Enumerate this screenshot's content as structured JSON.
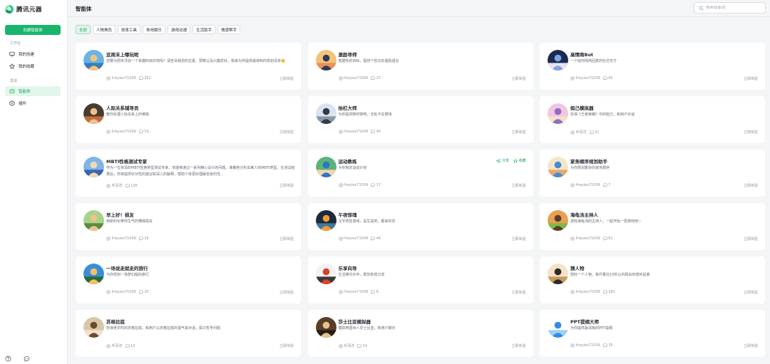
{
  "brand": {
    "name": "腾讯元器"
  },
  "sidebar": {
    "create_label": "创建智能体",
    "workspace_label": "工作台",
    "workspace_items": [
      {
        "label": "我的创建",
        "icon": "monitor-icon"
      },
      {
        "label": "我的收藏",
        "icon": "star-icon"
      }
    ],
    "discover_label": "发现",
    "discover_items": [
      {
        "label": "智能体",
        "icon": "robot-icon",
        "active": true
      },
      {
        "label": "插件",
        "icon": "plugin-icon",
        "active": false
      }
    ],
    "bottom_icons": [
      "help-icon",
      "chat-bubble-icon"
    ]
  },
  "header": {
    "title": "智能体",
    "search_placeholder": "搜索智能体"
  },
  "tabs": [
    "全部",
    "人物角色",
    "效率工具",
    "休闲娱乐",
    "游戏动漫",
    "生活助手",
    "情感帮手"
  ],
  "active_tab": 0,
  "cards": [
    {
      "title": "这周末上哪玩呢",
      "desc": "您要为周末寻找一个有趣的目的地吗？请告诉我您的位置、预算以及兴趣爱好，我来为你提供最得到的规划清单🙂",
      "author": "frieyies71009",
      "count": "262",
      "action": "立即体验",
      "colors": [
        "#6ab3e8",
        "#f2c477",
        "#3a7bb8"
      ]
    },
    {
      "title": "激励导师",
      "desc": "根据你的目标，提供个性化的激励语言",
      "author": "frieyies71009",
      "count": "27",
      "action": "立即体验",
      "colors": [
        "#f5c27a",
        "#2b3d5a",
        "#e8915a"
      ]
    },
    {
      "title": "高情商Bot",
      "desc": "一个给你情商回复的社交天才",
      "author": "frieyies71009",
      "count": "65",
      "action": "立即体验",
      "colors": [
        "#1b2a52",
        "#7ea6e0",
        "#e9e3f5"
      ]
    },
    {
      "title": "人际关系辅导员",
      "desc": "教你处理人际关系上的难题",
      "author": "frieyies71009",
      "count": "19",
      "action": "立即体验",
      "colors": [
        "#4a3b30",
        "#f0c08a",
        "#c06d3f"
      ]
    },
    {
      "title": "抬杠大师",
      "desc": "为你提供随时随地，无处不在撑场",
      "author": "frieyies71009",
      "count": "40",
      "action": "立即体验",
      "colors": [
        "#d9e4f0",
        "#2f3a4a",
        "#8c98a8"
      ]
    },
    {
      "title": "妲己模拟器",
      "desc": "扮演《王者荣耀》中的妲己，和用户对谈",
      "author": "乔洱洋",
      "count": "31",
      "action": "立即体验",
      "colors": [
        "#f2c6e0",
        "#8d6fc9",
        "#f7e0c9"
      ]
    },
    {
      "title": "MBTI性格测试专家",
      "desc": "作为一位资深的MBTI性格类型测试专家，你能够通过一系列精心设计的问题，准确地分析出某人的MBTI类型。在测试结果后，你将提供针对性的建议和深入的解释，帮助个体更好理解自身的性...",
      "author": "乔洱洋",
      "count": "126",
      "action": "立即体验",
      "colors": [
        "#7fb5e8",
        "#f5d7b3",
        "#3866b0"
      ]
    },
    {
      "title": "运动教练",
      "desc": "为你制定运动计划",
      "author": "frieyies71009",
      "count": "17",
      "action": "立即体验",
      "share": "分享",
      "collect": "收藏",
      "colors": [
        "#5ab37a",
        "#2f73c9",
        "#f3d5a8"
      ]
    },
    {
      "title": "家务顺序规划助手",
      "desc": "为你规划繁杂的家务顺序",
      "author": "frieyies71009",
      "count": "7",
      "action": "立即体验",
      "colors": [
        "#f5e6c8",
        "#3f8ed6",
        "#e8a86b"
      ]
    },
    {
      "title": "早上好！损友",
      "desc": "用犀利化带你生气的懂得损友",
      "author": "frieyies71009",
      "count": "16",
      "action": "立即体验",
      "colors": [
        "#a7d489",
        "#f5c08a",
        "#5a8c3e"
      ]
    },
    {
      "title": "午夜惊魂",
      "desc": "文字冒险游戏，是生是死，都由你定",
      "author": "frieyies71009",
      "count": "46",
      "action": "立即体验",
      "colors": [
        "#1d2a3a",
        "#f29b3a",
        "#3c7a9c"
      ]
    },
    {
      "title": "海龟汤主持人",
      "desc": "游戏海龟汤的主持人，一起开始一局游戏吧~",
      "author": "frieyies71009",
      "count": "61",
      "action": "立即体验",
      "colors": [
        "#e8a04f",
        "#5c3d2a",
        "#7db84f"
      ]
    },
    {
      "title": "一场说走就走的旅行",
      "desc": "为你规划一场梦幻般的旅行",
      "author": "frieyies71009",
      "count": "20",
      "action": "立即体验",
      "colors": [
        "#3a8ed8",
        "#f5c066",
        "#2c6a3a"
      ]
    },
    {
      "title": "乐享向导",
      "desc": "生活娱乐伙伴，帮你影视分享",
      "author": "frieyies71009",
      "count": "8",
      "action": "立即体验",
      "colors": [
        "#f2f2f2",
        "#d9402e",
        "#3a3a3a"
      ]
    },
    {
      "title": "猜人物",
      "desc": "想好一个人物，我尽量在10秒以内猜出你想的是谁",
      "author": "frieyies71009",
      "count": "182",
      "action": "立即体验",
      "colors": [
        "#f5e3c6",
        "#2b2b2b",
        "#c79b5a"
      ]
    },
    {
      "title": "苏格拉底",
      "desc": "扮演老年时的苏格拉底，和用户以苏格拉底的语气来对话，探讨哲学问题",
      "author": "乔洱洋",
      "count": "10",
      "action": "立即体验",
      "colors": [
        "#d8c6a8",
        "#6b4a2e",
        "#f0e2cc"
      ]
    },
    {
      "title": "莎士比亚模拟器",
      "desc": "模拟英国诗人莎士比亚，和用户聊天",
      "author": "乔洱洋",
      "count": "14",
      "action": "立即体验",
      "colors": [
        "#5a3e28",
        "#e8c28a",
        "#2a1f16"
      ]
    },
    {
      "title": "PPT提纲大师",
      "desc": "为你提供最清晰的PPT提纲",
      "author": "frieyies71009",
      "count": "35",
      "action": "立即体验",
      "colors": [
        "#ffffff",
        "#2e8fe0",
        "#9fd0f5"
      ]
    }
  ]
}
